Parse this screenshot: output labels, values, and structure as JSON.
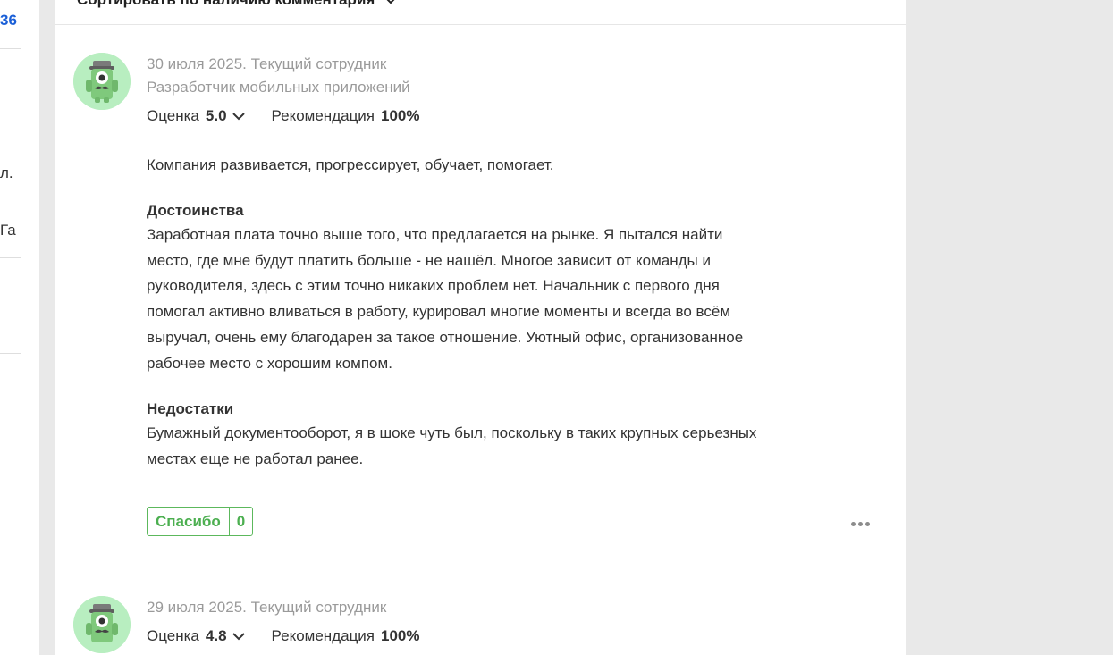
{
  "left_column": {
    "fragments": [
      "36",
      "л.",
      "Га"
    ]
  },
  "sort": {
    "label": "Сортировать по наличию комментария"
  },
  "reviews": [
    {
      "date_status": "30 июля 2025. Текущий сотрудник",
      "position": "Разработчик мобильных приложений",
      "score_label": "Оценка",
      "score_value": "5.0",
      "recommend_label": "Рекомендация",
      "recommend_value": "100%",
      "summary": "Компания развивается, прогрессирует, обучает, помогает.",
      "pros_title": "Достоинства",
      "pros_text": "Заработная плата точно выше того, что предлагается на рынке. Я пытался найти место, где мне будут платить больше - не нашёл. Многое зависит от команды и руководителя, здесь с этим точно никаких проблем нет. Начальник с первого дня помогал активно вливаться в работу, курировал многие моменты и всегда во всём выручал, очень ему благодарен за такое отношение. Уютный офис, организованное рабочее место с хорошим компом.",
      "cons_title": "Недостатки",
      "cons_text": "Бумажный документооборот, я в шоке чуть был, поскольку в таких крупных серьезных местах еще не работал ранее.",
      "thanks_label": "Спасибо",
      "thanks_count": "0"
    },
    {
      "date_status": "29 июля 2025. Текущий сотрудник",
      "score_label": "Оценка",
      "score_value": "4.8",
      "recommend_label": "Рекомендация",
      "recommend_value": "100%"
    }
  ],
  "icons": {
    "avatar": "monster-avatar-icon",
    "sort_chevron": "chevron-down-icon",
    "score_chevron": "chevron-down-icon",
    "more": "more-dots-icon"
  },
  "colors": {
    "link": "#1a5fd7",
    "accent_green": "#4caf50",
    "avatar_bg": "#b8eec0",
    "muted_text": "#9a9a9a"
  }
}
